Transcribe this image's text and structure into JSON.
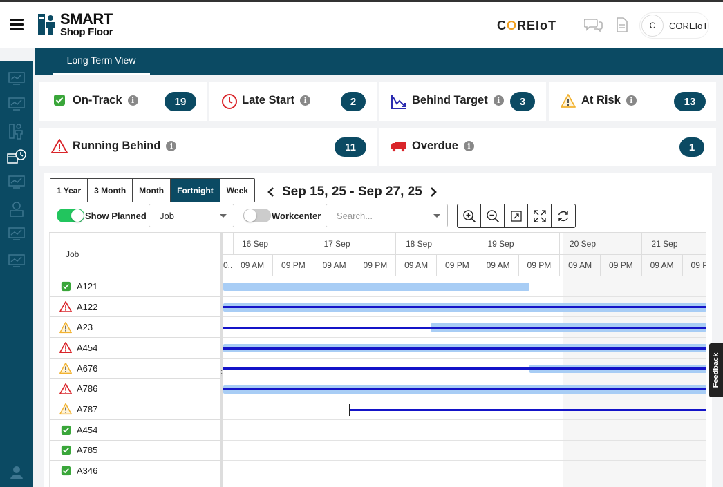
{
  "header": {
    "logo_line1": "SMART",
    "logo_line2": "Shop Floor",
    "brand_prefix": "C",
    "brand_o": "O",
    "brand_suffix": "REIoT",
    "user_initial": "C",
    "user_name": "COREIoT"
  },
  "nav": {
    "active_tab": "Long Term View"
  },
  "status_cards": [
    {
      "label": "On-Track",
      "count": "19",
      "icon": "check-square-icon",
      "color": "#3aa63a"
    },
    {
      "label": "Late Start",
      "count": "2",
      "icon": "clock-icon",
      "color": "#d9252a"
    },
    {
      "label": "Behind Target",
      "count": "3",
      "icon": "trend-down-icon",
      "color": "#2b2bb0"
    },
    {
      "label": "At Risk",
      "count": "13",
      "icon": "warning-outline-icon",
      "color": "#f2b230"
    },
    {
      "label": "Running Behind",
      "count": "11",
      "icon": "warning-red-icon",
      "color": "#d9252a"
    },
    {
      "label": "Overdue",
      "count": "1",
      "icon": "truck-icon",
      "color": "#d9252a"
    }
  ],
  "controls": {
    "ranges": [
      "1 Year",
      "3 Month",
      "Month",
      "Fortnight",
      "Week"
    ],
    "active_range": "Fortnight",
    "date_range": "Sep 15, 25 - Sep 27, 25",
    "show_planned_label": "Show Planned",
    "show_planned_on": true,
    "group_select": "Job",
    "workcenter_label": "Workcenter",
    "workcenter_on": false,
    "search_placeholder": "Search..."
  },
  "gantt": {
    "column_header": "Job",
    "days": [
      "16 Sep",
      "17 Sep",
      "18 Sep",
      "19 Sep",
      "20 Sep",
      "21 Sep"
    ],
    "halves": [
      "09 AM",
      "09 PM"
    ],
    "first_half_label": "0..",
    "jobs": [
      {
        "id": "A121",
        "status": "on-track"
      },
      {
        "id": "A122",
        "status": "running-behind"
      },
      {
        "id": "A23",
        "status": "at-risk"
      },
      {
        "id": "A454",
        "status": "running-behind"
      },
      {
        "id": "A676",
        "status": "at-risk"
      },
      {
        "id": "A786",
        "status": "running-behind"
      },
      {
        "id": "A787",
        "status": "at-risk"
      },
      {
        "id": "A454",
        "status": "on-track"
      },
      {
        "id": "A785",
        "status": "on-track"
      },
      {
        "id": "A346",
        "status": "on-track"
      }
    ]
  },
  "feedback_label": "Feedback"
}
